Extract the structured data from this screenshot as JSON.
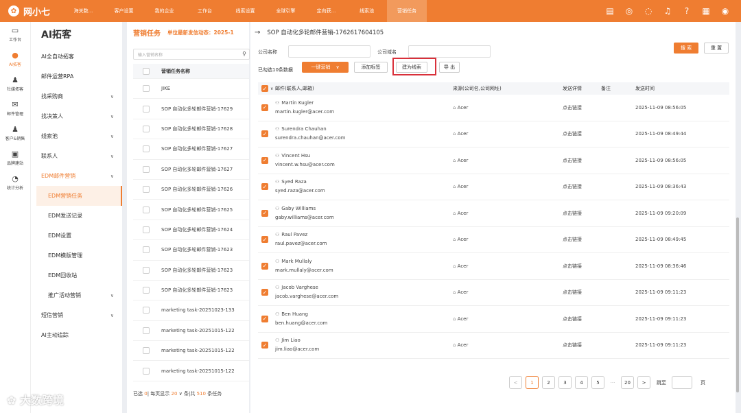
{
  "app": {
    "logo_text": "网小七",
    "accent": "#ef7d31"
  },
  "topnav": [
    "海关数...",
    "客户设置",
    "我的企业",
    "工作台",
    "线索设置",
    "全球引擎",
    "定向获...",
    "线索池",
    "营销任务"
  ],
  "topicons": [
    "document-icon",
    "whatsapp-icon",
    "headset-icon",
    "bell-icon",
    "help-icon",
    "grid-icon",
    "avatar-icon"
  ],
  "leftnav": [
    {
      "label": "工作台",
      "icon": "monitor-icon",
      "glyph": "▭"
    },
    {
      "label": "AI拓客",
      "icon": "ai-icon",
      "glyph": "●"
    },
    {
      "label": "社媒拓客",
      "icon": "user-icon",
      "glyph": "♟"
    },
    {
      "label": "邮件管理",
      "icon": "mail-icon",
      "glyph": "✉"
    },
    {
      "label": "客户&销售",
      "icon": "customers-icon",
      "glyph": "♟"
    },
    {
      "label": "品牌建站",
      "icon": "site-icon",
      "glyph": "▣"
    },
    {
      "label": "统计分析",
      "icon": "pie-icon",
      "glyph": "◔"
    }
  ],
  "subnav": {
    "title": "AI拓客",
    "items": [
      {
        "label": "AI全自动拓客",
        "chev": false
      },
      {
        "label": "邮件运营RPA",
        "chev": false
      },
      {
        "label": "找采购商",
        "chev": true
      },
      {
        "label": "找决策人",
        "chev": true
      },
      {
        "label": "线索池",
        "chev": true
      },
      {
        "label": "联系人",
        "chev": true
      },
      {
        "label": "EDM邮件营销",
        "chev": true,
        "orange": true
      },
      {
        "label": "EDM营销任务",
        "sub": true,
        "active": true
      },
      {
        "label": "EDM发送记录",
        "sub": true
      },
      {
        "label": "EDM设置",
        "sub": true
      },
      {
        "label": "EDM模版管理",
        "sub": true
      },
      {
        "label": "EDM回收站",
        "sub": true
      },
      {
        "label": "推广活动营销",
        "sub": true,
        "chev": true
      },
      {
        "label": "短信营销",
        "chev": true
      },
      {
        "label": "AI主动追踪",
        "chev": false
      }
    ]
  },
  "listpanel": {
    "title": "营销任务",
    "subtitle": "单位最新发信动态：2025-1",
    "search_placeholder": "输入营销名称",
    "col_header": "营销任务名称",
    "rows": [
      "JIKE",
      "SOP 自动化多轮邮件营销-17629",
      "SOP 自动化多轮邮件营销-17628",
      "SOP 自动化多轮邮件营销-17627",
      "SOP 自动化多轮邮件营销-17627",
      "SOP 自动化多轮邮件营销-17626",
      "SOP 自动化多轮邮件营销-17625",
      "SOP 自动化多轮邮件营销-17624",
      "SOP 自动化多轮邮件营销-17623",
      "SOP 自动化多轮邮件营销-17623",
      "SOP 自动化多轮邮件营销-17623",
      "marketing task-20251023-133",
      "marketing task-20251015-122",
      "marketing task-20251015-122",
      "marketing task-20251015-122"
    ],
    "footer": {
      "a": "已选 ",
      "sel": "0",
      "b": "| 每页显示 ",
      "per": "20",
      "c": " ∨ 条|共 ",
      "total": "510",
      "d": " 条任务"
    }
  },
  "main": {
    "breadcrumb": "SOP 自动化多轮邮件营销-1762617604105",
    "company_name_label": "公司名称",
    "company_domain_label": "公司域名",
    "search_btn": "搜 索",
    "reset_btn": "重 置",
    "selected_text": "已勾选10条数据",
    "one_click_btn": "一键营销",
    "add_tag_btn": "添加标签",
    "create_lead_btn": "建为线索",
    "export_btn": "导 出",
    "columns": [
      "邮件(联系人,邮箱)",
      "来源(公司名,公司网址)",
      "发送详情",
      "备注",
      "发送时间"
    ],
    "rows": [
      {
        "name": "Martin Kugler",
        "email": "martin.kugler@acer.com",
        "source": "Acer",
        "detail": "点击链接",
        "note": "",
        "time": "2025-11-09 08:56:05"
      },
      {
        "name": "Surendra Chauhan",
        "email": "surendra.chauhan@acer.com",
        "source": "Acer",
        "detail": "点击链接",
        "note": "",
        "time": "2025-11-09 08:49:44"
      },
      {
        "name": "Vincent Hsu",
        "email": "vincent.w.hsu@acer.com",
        "source": "Acer",
        "detail": "点击链接",
        "note": "",
        "time": "2025-11-09 08:56:05"
      },
      {
        "name": "Syed Raza",
        "email": "syed.raza@acer.com",
        "source": "Acer",
        "detail": "点击链接",
        "note": "",
        "time": "2025-11-09 08:36:43"
      },
      {
        "name": "Gaby Williams",
        "email": "gaby.williams@acer.com",
        "source": "Acer",
        "detail": "点击链接",
        "note": "",
        "time": "2025-11-09 09:20:09"
      },
      {
        "name": "Raul Pavez",
        "email": "raul.pavez@acer.com",
        "source": "Acer",
        "detail": "点击链接",
        "note": "",
        "time": "2025-11-09 08:49:45"
      },
      {
        "name": "Mark Mullaly",
        "email": "mark.mullaly@acer.com",
        "source": "Acer",
        "detail": "点击链接",
        "note": "",
        "time": "2025-11-09 08:36:46"
      },
      {
        "name": "Jacob Varghese",
        "email": "jacob.varghese@acer.com",
        "source": "Acer",
        "detail": "点击链接",
        "note": "",
        "time": "2025-11-09 09:11:23"
      },
      {
        "name": "Ben Huang",
        "email": "ben.huang@acer.com",
        "source": "Acer",
        "detail": "点击链接",
        "note": "",
        "time": "2025-11-09 09:11:23"
      },
      {
        "name": "Jim Liao",
        "email": "jim.liao@acer.com",
        "source": "Acer",
        "detail": "点击链接",
        "note": "",
        "time": "2025-11-09 09:11:23"
      }
    ],
    "pagination": {
      "prev": "<",
      "pages": [
        "1",
        "2",
        "3",
        "4",
        "5"
      ],
      "ellipsis": "···",
      "last": "20",
      "next": ">",
      "current": "1",
      "jump_label": "跳至",
      "page_unit": "页"
    }
  },
  "watermark": "大数跨境"
}
